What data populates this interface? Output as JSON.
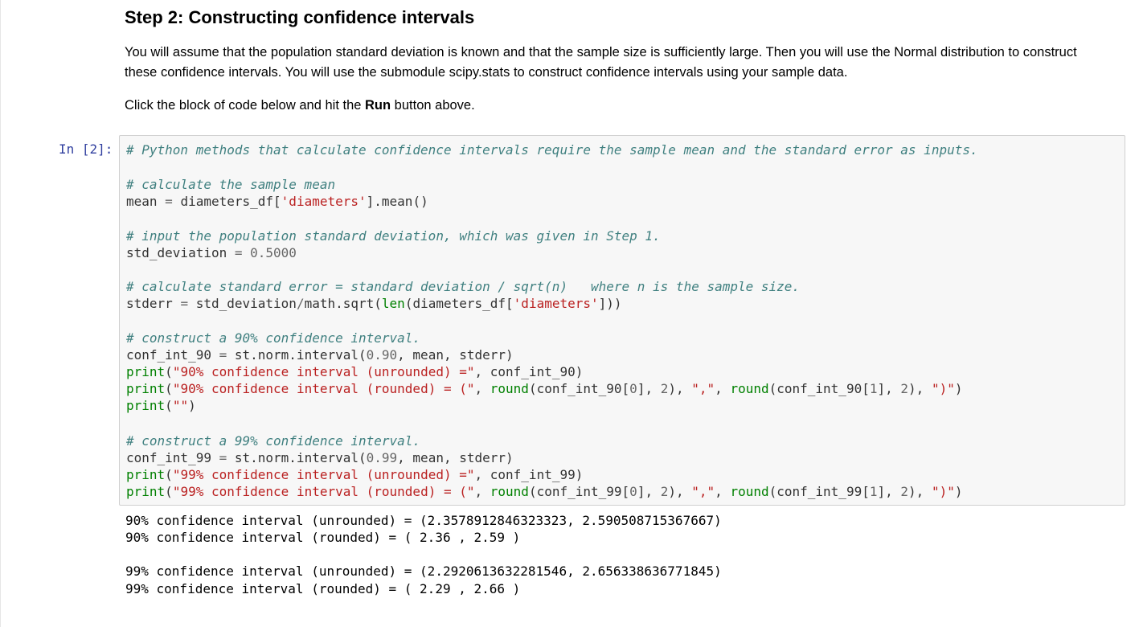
{
  "markdown": {
    "title": "Step 2: Constructing confidence intervals",
    "para1": "You will assume that the population standard deviation is known and that the sample size is sufficiently large. Then you will use the Normal distribution to construct these confidence intervals. You will use the submodule scipy.stats to construct confidence intervals using your sample data.",
    "para2_before": "Click the block of code below and hit the ",
    "para2_bold": "Run",
    "para2_after": " button above."
  },
  "cell": {
    "prompt": "In [2]:",
    "code": {
      "l1_comment": "# Python methods that calculate confidence intervals require the sample mean and the standard error as inputs.",
      "l2_comment": "# calculate the sample mean",
      "l3_a": "mean ",
      "l3_eq": "=",
      "l3_b": " diameters_df[",
      "l3_str": "'diameters'",
      "l3_c": "].mean()",
      "l4_comment": "# input the population standard deviation, which was given in Step 1.",
      "l5_a": "std_deviation ",
      "l5_eq": "=",
      "l5_sp": " ",
      "l5_num": "0.5000",
      "l6_comment": "# calculate standard error = standard deviation / sqrt(n)   where n is the sample size.",
      "l7_a": "stderr ",
      "l7_eq": "=",
      "l7_b": " std_deviation",
      "l7_div": "/",
      "l7_c": "math.sqrt(",
      "l7_len": "len",
      "l7_d": "(diameters_df[",
      "l7_str": "'diameters'",
      "l7_e": "]))",
      "l8_comment": "# construct a 90% confidence interval.",
      "l9_a": "conf_int_90 ",
      "l9_eq": "=",
      "l9_b": " st.norm.interval(",
      "l9_num": "0.90",
      "l9_c": ", mean, stderr)",
      "l10_print": "print",
      "l10_a": "(",
      "l10_str": "\"90% confidence interval (unrounded) =\"",
      "l10_b": ", conf_int_90)",
      "l11_print": "print",
      "l11_a": "(",
      "l11_str1": "\"90% confidence interval (rounded) = (\"",
      "l11_b": ", ",
      "l11_round1": "round",
      "l11_c": "(conf_int_90[",
      "l11_n0": "0",
      "l11_d": "], ",
      "l11_n2a": "2",
      "l11_e": "), ",
      "l11_str2": "\",\"",
      "l11_f": ", ",
      "l11_round2": "round",
      "l11_g": "(conf_int_90[",
      "l11_n1": "1",
      "l11_h": "], ",
      "l11_n2b": "2",
      "l11_i": "), ",
      "l11_str3": "\")\"",
      "l11_j": ")",
      "l12_print": "print",
      "l12_a": "(",
      "l12_str": "\"\"",
      "l12_b": ")",
      "l13_comment": "# construct a 99% confidence interval.",
      "l14_a": "conf_int_99 ",
      "l14_eq": "=",
      "l14_b": " st.norm.interval(",
      "l14_num": "0.99",
      "l14_c": ", mean, stderr)",
      "l15_print": "print",
      "l15_a": "(",
      "l15_str": "\"99% confidence interval (unrounded) =\"",
      "l15_b": ", conf_int_99)",
      "l16_print": "print",
      "l16_a": "(",
      "l16_str1": "\"99% confidence interval (rounded) = (\"",
      "l16_b": ", ",
      "l16_round1": "round",
      "l16_c": "(conf_int_99[",
      "l16_n0": "0",
      "l16_d": "], ",
      "l16_n2a": "2",
      "l16_e": "), ",
      "l16_str2": "\",\"",
      "l16_f": ", ",
      "l16_round2": "round",
      "l16_g": "(conf_int_99[",
      "l16_n1": "1",
      "l16_h": "], ",
      "l16_n2b": "2",
      "l16_i": "), ",
      "l16_str3": "\")\"",
      "l16_j": ")"
    },
    "output": [
      "90% confidence interval (unrounded) = (2.3578912846323323, 2.590508715367667)",
      "90% confidence interval (rounded) = ( 2.36 , 2.59 )",
      "",
      "99% confidence interval (unrounded) = (2.2920613632281546, 2.656338636771845)",
      "99% confidence interval (rounded) = ( 2.29 , 2.66 )"
    ]
  },
  "colors": {
    "prompt": "#303f9f",
    "comment": "#408080",
    "string": "#ba2121",
    "builtin": "#008000",
    "number": "#666666",
    "cell_bg": "#f7f7f7",
    "cell_border": "#cfcfcf"
  }
}
